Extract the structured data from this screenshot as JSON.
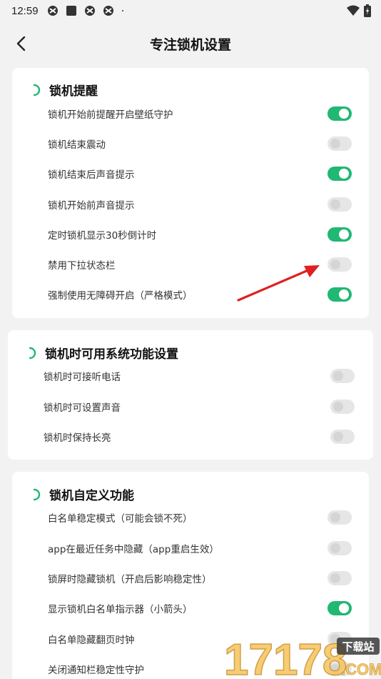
{
  "status_bar": {
    "time": "12:59"
  },
  "header": {
    "title": "专注锁机设置"
  },
  "sections": [
    {
      "title": "锁机提醒",
      "items": [
        {
          "label": "锁机开始前提醒开启壁纸守护",
          "on": true
        },
        {
          "label": "锁机结束震动",
          "on": false
        },
        {
          "label": "锁机结束后声音提示",
          "on": true
        },
        {
          "label": "锁机开始前声音提示",
          "on": false
        },
        {
          "label": "定时锁机显示30秒倒计时",
          "on": true
        },
        {
          "label": "禁用下拉状态栏",
          "on": false
        },
        {
          "label": "强制使用无障碍开启（严格模式）",
          "on": true
        }
      ]
    },
    {
      "title": "锁机时可用系统功能设置",
      "items": [
        {
          "label": "锁机时可接听电话",
          "on": false
        },
        {
          "label": "锁机时可设置声音",
          "on": false
        },
        {
          "label": "锁机时保持长亮",
          "on": false
        }
      ]
    },
    {
      "title": "锁机自定义功能",
      "items": [
        {
          "label": "白名单稳定模式（可能会锁不死）",
          "on": false
        },
        {
          "label": "app在最近任务中隐藏（app重启生效）",
          "on": false
        },
        {
          "label": "锁屏时隐藏锁机（开启后影响稳定性）",
          "on": false
        },
        {
          "label": "显示锁机白名单指示器（小箭头）",
          "on": true
        },
        {
          "label": "白名单隐藏翻页时钟",
          "on": false
        },
        {
          "label": "关闭通知栏稳定性守护",
          "on": false
        }
      ]
    }
  ],
  "watermark": {
    "text": "17178",
    "badge": "下载站",
    "suffix": ".COM"
  },
  "colors": {
    "accent": "#20b873",
    "background": "#f2f2f2",
    "card": "#ffffff",
    "arrow": "#e02020"
  }
}
